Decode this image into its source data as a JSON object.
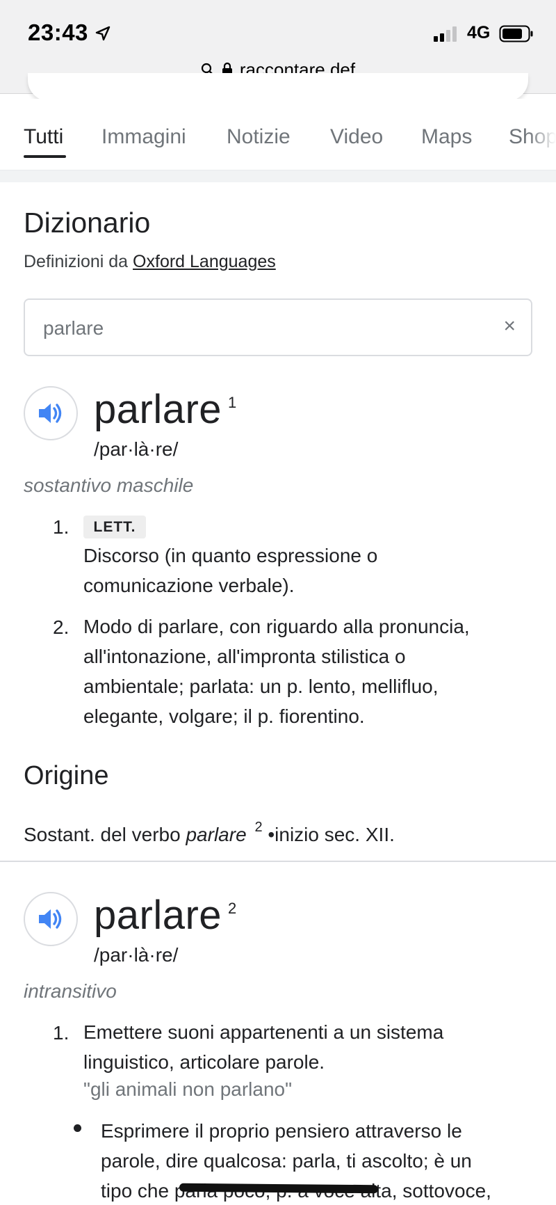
{
  "status_bar": {
    "time": "23:43",
    "network": "4G"
  },
  "url_bar": {
    "text": "raccontare def"
  },
  "tabs": [
    {
      "label": "Tutti"
    },
    {
      "label": "Immagini"
    },
    {
      "label": "Notizie"
    },
    {
      "label": "Video"
    },
    {
      "label": "Maps"
    },
    {
      "label": "Shop"
    }
  ],
  "dictionary": {
    "title": "Dizionario",
    "source_prefix": "Definizioni da",
    "source_link": "Oxford Languages",
    "input_value": "parlare",
    "clear_symbol": "×"
  },
  "entry1": {
    "word": "parlare",
    "sup": "1",
    "phonetic": "/par·là·re/",
    "pos": "sostantivo maschile",
    "defs": [
      {
        "num": "1.",
        "tag": "LETT.",
        "lines": [
          "Discorso (in quanto espressione o",
          "comunicazione verbale)."
        ]
      },
      {
        "num": "2.",
        "lines": [
          "Modo di parlare, con riguardo alla pronuncia,",
          "all'intonazione, all'impronta stilistica o",
          "ambientale; parlata: un p. lento, mellifluo,",
          "elegante, volgare; il p. fiorentino."
        ]
      }
    ],
    "origin_title": "Origine",
    "origin": {
      "before": "Sostant. del verbo",
      "word": "parlare",
      "sup": "2",
      "after": "•inizio sec. XII."
    }
  },
  "entry2": {
    "word": "parlare",
    "sup": "2",
    "phonetic": "/par·là·re/",
    "pos": "intransitivo",
    "defs": [
      {
        "num": "1.",
        "lines": [
          "Emettere suoni appartenenti a un sistema",
          "linguistico, articolare parole."
        ],
        "example": "\"gli animali non parlano\""
      }
    ],
    "sub": {
      "lines": [
        "Esprimere il proprio pensiero attraverso le",
        "parole, dire qualcosa: parla, ti ascolto; è un"
      ],
      "line3_start": "tipo che",
      "line3_hidden": "parla poco; p. a voce",
      "line3_end": "alta, sottovoce,"
    }
  },
  "colors": {
    "accent_blue": "#4285f4",
    "text": "#202124",
    "secondary": "#70757a"
  }
}
